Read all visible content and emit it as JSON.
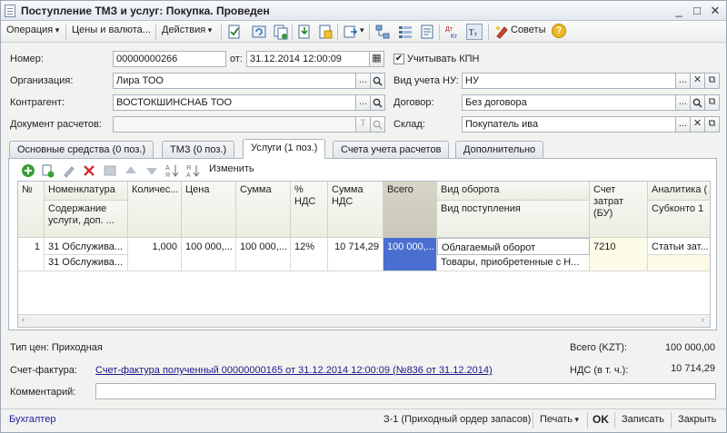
{
  "window": {
    "title": "Поступление ТМЗ и услуг: Покупка. Проведен",
    "controls": {
      "minimize": "_",
      "maximize": "□",
      "close": "✕"
    }
  },
  "toolbar": {
    "operation": "Операция",
    "prices": "Цены и валюта...",
    "actions": "Действия",
    "tips": "Советы",
    "help": "?"
  },
  "form": {
    "number_label": "Номер:",
    "number_value": "00000000266",
    "date_label": "от:",
    "date_value": "31.12.2014 12:00:09",
    "kpn_label": "Учитывать КПН",
    "kpn_checked": "✔",
    "org_label": "Организация:",
    "org_value": "Лира ТОО",
    "nu_label": "Вид учета НУ:",
    "nu_value": "НУ",
    "contractor_label": "Контрагент:",
    "contractor_value": "ВОСТОКШИНСНАБ ТОО",
    "contract_label": "Договор:",
    "contract_value": "Без договора",
    "settlement_label": "Документ расчетов:",
    "settlement_value": "",
    "warehouse_label": "Склад:",
    "warehouse_value": "Покупатель ива",
    "btn_select": "...",
    "btn_search": "🔍",
    "btn_clear": "✕",
    "btn_open": "⧉",
    "btn_t": "T"
  },
  "tabs": [
    {
      "label": "Основные средства (0 поз.)"
    },
    {
      "label": "ТМЗ (0 поз.)"
    },
    {
      "label": "Услуги (1 поз.)"
    },
    {
      "label": "Счета учета расчетов"
    },
    {
      "label": "Дополнительно"
    }
  ],
  "panel_toolbar": {
    "change": "Изменить"
  },
  "grid": {
    "headers": {
      "n": "№",
      "nomenclature": "Номенклатура",
      "content": "Содержание услуги, доп. ...",
      "qty": "Количес...",
      "price": "Цена",
      "sum": "Сумма",
      "vat_pct": "% НДС",
      "vat_sum": "Сумма НДС",
      "total": "Всего",
      "turnover": "Вид оборота",
      "receipt": "Вид поступления",
      "cost_account": "Счет затрат (БУ)",
      "analytics": "Аналитика (",
      "subconto": "Субконто 1"
    },
    "row": {
      "n": "1",
      "nomenclature": "31 Обслужива...",
      "content": "31 Обслужива...",
      "qty": "1,000",
      "price": "100 000,...",
      "sum": "100 000,...",
      "vat_pct": "12%",
      "vat_sum": "10 714,29",
      "total": "100 000,...",
      "turnover": "Облагаемый оборот",
      "receipt": "Товары, приобретенные с Н...",
      "cost_account": "7210",
      "subconto": "Статьи зат..."
    }
  },
  "footer": {
    "price_type": "Тип цен: Приходная",
    "total_label": "Всего (KZT):",
    "total_value": "100 000,00",
    "invoice_label": "Счет-фактура:",
    "invoice_link": "Счет-фактура полученный 00000000165 от 31.12.2014 12:00:09 (№836 от 31.12.2014)",
    "vat_label": "НДС (в т. ч.):",
    "vat_value": "10 714,29",
    "comment_label": "Комментарий:",
    "comment_value": ""
  },
  "bottombar": {
    "accountant": "Бухгалтер",
    "receipt_order": "З-1 (Приходный ордер запасов)",
    "print": "Печать",
    "ok": "OK",
    "save": "Записать",
    "close": "Закрыть"
  }
}
